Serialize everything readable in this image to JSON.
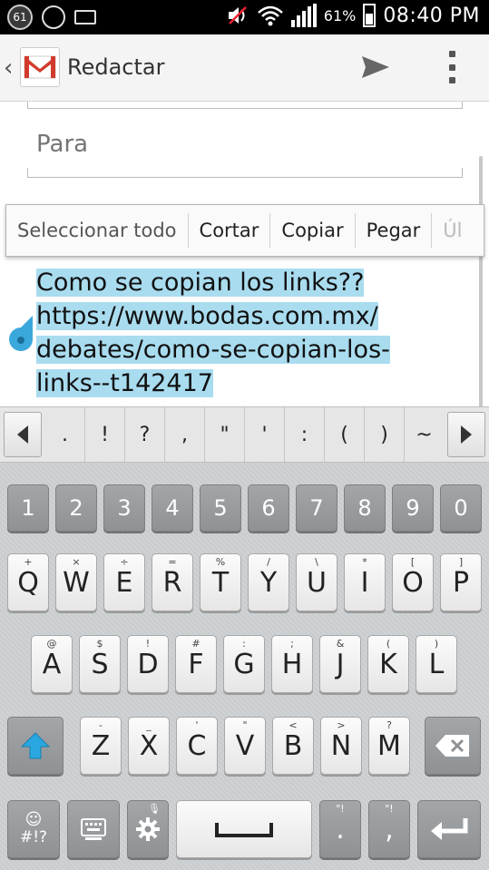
{
  "status_bar": {
    "notification_count": "61",
    "battery_percent": "61%",
    "time": "08:40 PM"
  },
  "action_bar": {
    "title": "Redactar",
    "app_icon": "gmail-icon",
    "send_icon": "send-icon",
    "menu_icon": "overflow-menu-icon"
  },
  "compose": {
    "to_placeholder": "Para"
  },
  "context_menu": {
    "items": [
      "Seleccionar todo",
      "Cortar",
      "Copiar",
      "Pegar",
      "Úl"
    ]
  },
  "body": {
    "lines": [
      "Como se copian los links??",
      "https://www.bodas.com.mx/",
      "debates/como-se-copian-los-",
      "links--t142417"
    ],
    "selection_color": "#a9dcef"
  },
  "symbol_row": {
    "keys": [
      ".",
      "!",
      "?",
      ",",
      "\"",
      "'",
      ":",
      "(",
      ")",
      "~"
    ]
  },
  "keyboard": {
    "numbers": [
      "1",
      "2",
      "3",
      "4",
      "5",
      "6",
      "7",
      "8",
      "9",
      "0"
    ],
    "row1": [
      {
        "label": "Q",
        "sub": "+"
      },
      {
        "label": "W",
        "sub": "×"
      },
      {
        "label": "E",
        "sub": "÷"
      },
      {
        "label": "R",
        "sub": "="
      },
      {
        "label": "T",
        "sub": "%"
      },
      {
        "label": "Y",
        "sub": "/"
      },
      {
        "label": "U",
        "sub": "\\"
      },
      {
        "label": "I",
        "sub": "*"
      },
      {
        "label": "O",
        "sub": "["
      },
      {
        "label": "P",
        "sub": "]"
      }
    ],
    "row2": [
      {
        "label": "A",
        "sub": "@"
      },
      {
        "label": "S",
        "sub": "$"
      },
      {
        "label": "D",
        "sub": "!"
      },
      {
        "label": "F",
        "sub": "#"
      },
      {
        "label": "G",
        "sub": ":"
      },
      {
        "label": "H",
        "sub": ";"
      },
      {
        "label": "J",
        "sub": "&"
      },
      {
        "label": "K",
        "sub": "("
      },
      {
        "label": "L",
        "sub": ")"
      }
    ],
    "row3": [
      {
        "label": "Z",
        "sub": "-"
      },
      {
        "label": "X",
        "sub": "_"
      },
      {
        "label": "C",
        "sub": "'"
      },
      {
        "label": "V",
        "sub": "\""
      },
      {
        "label": "B",
        "sub": "<"
      },
      {
        "label": "N",
        "sub": ">"
      },
      {
        "label": "M",
        "sub": "?"
      }
    ],
    "symbols_key": "#!?",
    "period_key": ".",
    "comma_key": ",",
    "period_sub": "\"!",
    "comma_sub": "\"!",
    "accent_color": "#2aa7e0"
  }
}
